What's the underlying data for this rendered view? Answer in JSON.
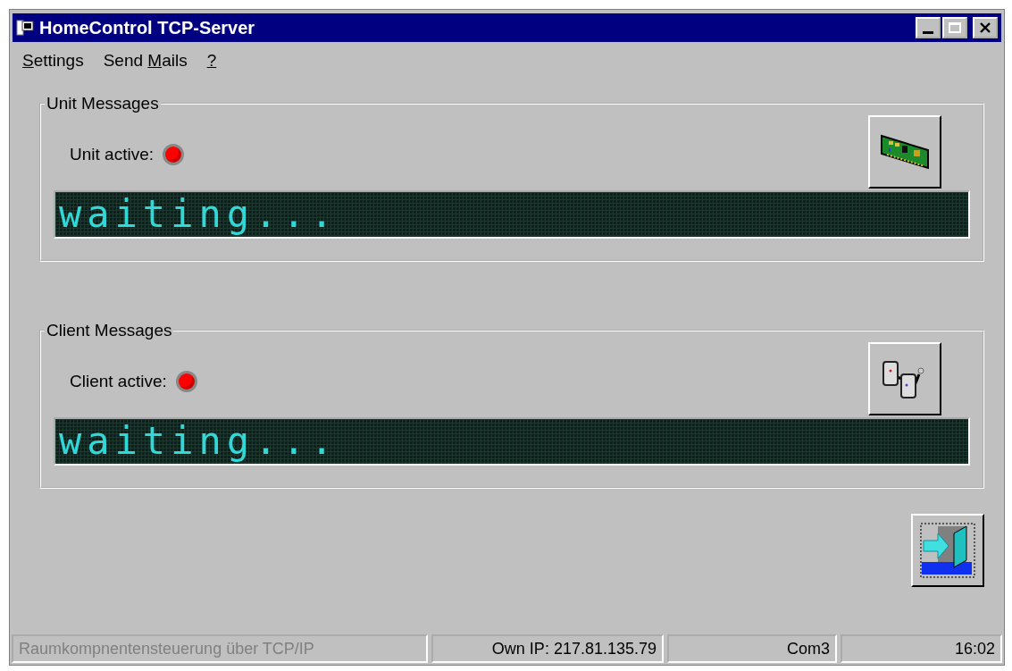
{
  "window": {
    "title": "HomeControl TCP-Server"
  },
  "menu": [
    {
      "key": "S",
      "post": "ettings"
    },
    {
      "pre": "Send ",
      "key": "M",
      "post": "ails"
    },
    {
      "key": "?"
    }
  ],
  "groups": [
    {
      "title": "Unit Messages",
      "label": "Unit active:",
      "led": {
        "color": "#ff0000"
      },
      "display": "waiting...",
      "kind": "card"
    },
    {
      "title": "Client Messages",
      "label": "Client active:",
      "led": {
        "color": "#ff0000"
      },
      "display": "waiting...",
      "kind": "network"
    }
  ],
  "status_bar": [
    {
      "text": "Raumkompnentensteuerung über TCP/IP",
      "disabled": true
    },
    {
      "text": "Own IP: 217.81.135.79",
      "disabled": false
    },
    {
      "text": "Com3",
      "disabled": false
    },
    {
      "text": "16:02",
      "disabled": false
    }
  ]
}
